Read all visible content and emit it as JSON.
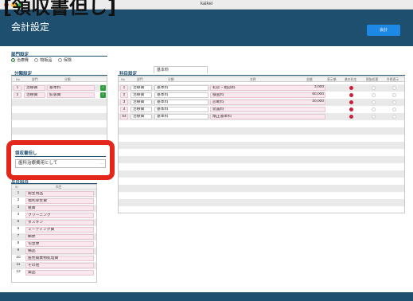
{
  "window": {
    "title": "kaikei"
  },
  "overlay_title": "[領収書但し]",
  "header": {
    "title": "会計設定",
    "top_button_label": "会計"
  },
  "department": {
    "label": "部門設定",
    "options": [
      {
        "label": "治療費",
        "selected": true
      },
      {
        "label": "物販品",
        "selected": false
      },
      {
        "label": "保険",
        "selected": false
      }
    ]
  },
  "category": {
    "label": "分類設定",
    "columns": [
      "No",
      "部門",
      "分類"
    ],
    "rows": [
      {
        "no": "1",
        "dept": "治療費",
        "name": "基本料"
      },
      {
        "no": "2",
        "dept": "治療費",
        "name": "拡張費"
      }
    ]
  },
  "subject": {
    "label": "科目設定",
    "tab_label": "基本料",
    "columns": [
      "No",
      "部門",
      "分類",
      "名称",
      "金額",
      "表示順",
      "基本料金",
      "税抜処理",
      "外税表示"
    ],
    "rows": [
      {
        "no": "1",
        "dept": "治療費",
        "category": "基本料",
        "name": "初診・相談料",
        "amount": "3,000",
        "flags": [
          true,
          false,
          false
        ]
      },
      {
        "no": "2",
        "dept": "治療費",
        "category": "基本料",
        "name": "検査料",
        "amount": "60,000",
        "flags": [
          true,
          false,
          false
        ]
      },
      {
        "no": "3",
        "dept": "治療費",
        "category": "基本料",
        "name": "診断料",
        "amount": "20,000",
        "flags": [
          true,
          false,
          false
        ]
      },
      {
        "no": "4",
        "dept": "治療費",
        "category": "基本料",
        "name": "装置料",
        "amount": "",
        "flags": [
          true,
          false,
          false
        ]
      },
      {
        "no": "54",
        "dept": "治療費",
        "category": "基本料",
        "name": "矯正基本料",
        "amount": "",
        "flags": [
          true,
          false,
          false
        ]
      }
    ]
  },
  "receipt": {
    "label": "領収書但し",
    "value": "歯科治療費用として",
    "caret": "..."
  },
  "items": {
    "label": "品目科目",
    "columns": [
      "ID",
      "科目"
    ],
    "rows": [
      {
        "id": "1",
        "name": "衛生用品"
      },
      {
        "id": "2",
        "name": "福利厚生費"
      },
      {
        "id": "3",
        "name": "雑費"
      },
      {
        "id": "4",
        "name": "クリーニング"
      },
      {
        "id": "5",
        "name": "ダスキン"
      },
      {
        "id": "6",
        "name": "ミーティング費"
      },
      {
        "id": "7",
        "name": "郵便"
      },
      {
        "id": "8",
        "name": "宅急便"
      },
      {
        "id": "9",
        "name": "備品"
      },
      {
        "id": "10",
        "name": "医性廃棄物処理費"
      },
      {
        "id": "11",
        "name": "その他"
      },
      {
        "id": "12",
        "name": "薬品"
      }
    ]
  },
  "colors": {
    "header": "#1e4f6e",
    "accent_button": "#1e88e5",
    "cell_pink": "#fbe7ee",
    "flag_on": "#cc1f3a",
    "edit_green": "#2e9e3e",
    "annotation_red": "#e3271a"
  }
}
